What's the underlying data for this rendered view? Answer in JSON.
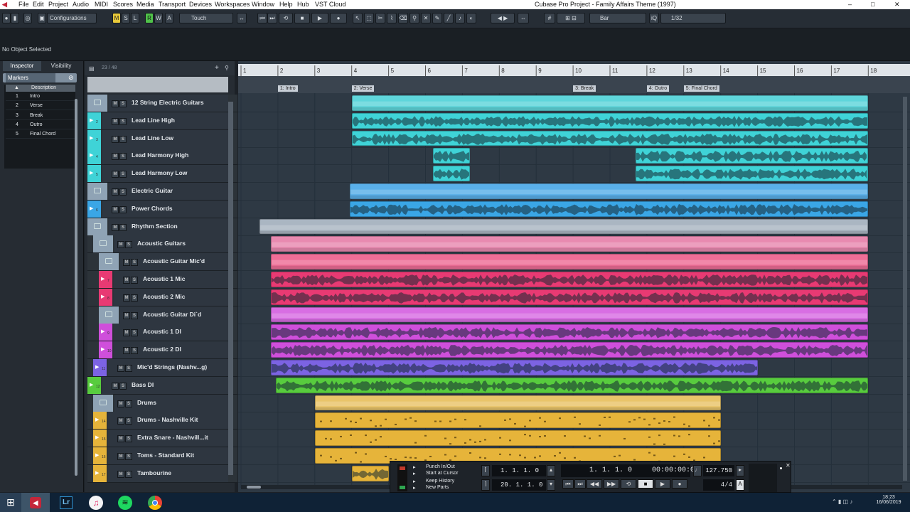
{
  "menu": [
    "File",
    "Edit",
    "Project",
    "Audio",
    "MIDI",
    "Scores",
    "Media",
    "Transport",
    "Devices",
    "Workspaces",
    "Window",
    "Help",
    "Hub",
    "VST Cloud"
  ],
  "window_title": "Cubase Pro Project - Family Affairs Theme (1997)",
  "window_controls": {
    "min": "–",
    "max": "□",
    "close": "✕"
  },
  "toolbar": {
    "configurations": "Configurations",
    "state_buttons": [
      "M",
      "S",
      "L",
      "R",
      "W",
      "A"
    ],
    "automation_mode": "Touch",
    "snap_type": "Bar",
    "quantize": "1/32",
    "iq": "iQ"
  },
  "info_line": "No Object Selected",
  "inspector": {
    "tabs": [
      "Inspector",
      "Visibility"
    ],
    "section": "Markers",
    "column_header": "Description",
    "markers": [
      {
        "id": "1",
        "description": "Intro"
      },
      {
        "id": "2",
        "description": "Verse"
      },
      {
        "id": "3",
        "description": "Break"
      },
      {
        "id": "4",
        "description": "Outro"
      },
      {
        "id": "5",
        "description": "Final Chord"
      }
    ]
  },
  "tracklist": {
    "count": "23 / 48",
    "tracks": [
      {
        "name": "12 String Electric Guitars",
        "num": "",
        "indent": 0,
        "folder": true,
        "color": "#8fa3b5"
      },
      {
        "name": "Lead Line High",
        "num": "2",
        "indent": 0,
        "folder": false,
        "color": "#3fd3d7"
      },
      {
        "name": "Lead Line Low",
        "num": "3",
        "indent": 0,
        "folder": false,
        "color": "#3fd3d7"
      },
      {
        "name": "Lead Harmony High",
        "num": "4",
        "indent": 0,
        "folder": false,
        "color": "#3fd3d7"
      },
      {
        "name": "Lead Harmony Low",
        "num": "5",
        "indent": 0,
        "folder": false,
        "color": "#3fd3d7"
      },
      {
        "name": "Electric Guitar",
        "num": "",
        "indent": 0,
        "folder": true,
        "color": "#8fa3b5"
      },
      {
        "name": "Power Chords",
        "num": "6",
        "indent": 0,
        "folder": false,
        "color": "#3aa6e6"
      },
      {
        "name": "Rhythm Section",
        "num": "",
        "indent": 0,
        "folder": true,
        "color": "#8fa3b5"
      },
      {
        "name": "Acoustic Guitars",
        "num": "",
        "indent": 1,
        "folder": true,
        "color": "#8fa3b5"
      },
      {
        "name": "Acoustic Guitar Mic'd",
        "num": "",
        "indent": 2,
        "folder": true,
        "color": "#8fa3b5"
      },
      {
        "name": "Acoustic 1 Mic",
        "num": "7",
        "indent": 2,
        "folder": false,
        "color": "#e83a73"
      },
      {
        "name": "Acoustic 2 Mic",
        "num": "8",
        "indent": 2,
        "folder": false,
        "color": "#e83a73"
      },
      {
        "name": "Acoustic Guitar Di`d",
        "num": "",
        "indent": 2,
        "folder": true,
        "color": "#8fa3b5"
      },
      {
        "name": "Acoustic 1 DI",
        "num": "9",
        "indent": 2,
        "folder": false,
        "color": "#cf4fdb"
      },
      {
        "name": "Acoustic 2 DI",
        "num": "10",
        "indent": 2,
        "folder": false,
        "color": "#cf4fdb"
      },
      {
        "name": "Mic'd Strings (Nashv...g)",
        "num": "11",
        "indent": 1,
        "folder": false,
        "color": "#7c63e3"
      },
      {
        "name": "Bass DI",
        "num": "12",
        "indent": 0,
        "folder": false,
        "color": "#58cc3e"
      },
      {
        "name": "Drums",
        "num": "",
        "indent": 1,
        "folder": true,
        "color": "#8fa3b5"
      },
      {
        "name": "Drums - Nashville Kit",
        "num": "14",
        "indent": 1,
        "folder": false,
        "color": "#e6b43a"
      },
      {
        "name": "Extra Snare - Nashvill...it",
        "num": "15",
        "indent": 1,
        "folder": false,
        "color": "#e6b43a"
      },
      {
        "name": "Toms - Standard Kit",
        "num": "16",
        "indent": 1,
        "folder": false,
        "color": "#e6b43a"
      },
      {
        "name": "Tambourine",
        "num": "17",
        "indent": 1,
        "folder": false,
        "color": "#e6b43a"
      }
    ]
  },
  "ruler": {
    "bars": [
      "1",
      "2",
      "3",
      "4",
      "5",
      "6",
      "7",
      "8",
      "9",
      "10",
      "11",
      "12",
      "13",
      "14",
      "15",
      "16",
      "17",
      "18"
    ],
    "markers": [
      {
        "label": "1: Intro",
        "bar": 2
      },
      {
        "label": "2: Verse",
        "bar": 4
      },
      {
        "label": "3: Break",
        "bar": 10
      },
      {
        "label": "4: Outro",
        "bar": 12
      },
      {
        "label": "5: Final Chord",
        "bar": 13
      }
    ]
  },
  "clips": [
    {
      "track": 0,
      "start": 4,
      "end": 18,
      "color": "#5fd6db",
      "kind": "folder"
    },
    {
      "track": 1,
      "start": 4,
      "end": 18,
      "color": "#3fd3d7",
      "kind": "audio"
    },
    {
      "track": 2,
      "start": 4,
      "end": 18,
      "color": "#3fd3d7",
      "kind": "audio"
    },
    {
      "track": 3,
      "start": 6.2,
      "end": 7.2,
      "color": "#3fd3d7",
      "kind": "audio"
    },
    {
      "track": 3,
      "start": 11.7,
      "end": 18,
      "color": "#3fd3d7",
      "kind": "audio"
    },
    {
      "track": 4,
      "start": 6.2,
      "end": 7.2,
      "color": "#3fd3d7",
      "kind": "audio"
    },
    {
      "track": 4,
      "start": 11.7,
      "end": 18,
      "color": "#3fd3d7",
      "kind": "audio"
    },
    {
      "track": 5,
      "start": 3.95,
      "end": 18,
      "color": "#5ab0ea",
      "kind": "folder"
    },
    {
      "track": 6,
      "start": 3.95,
      "end": 18,
      "color": "#3aa6e6",
      "kind": "audio"
    },
    {
      "track": 7,
      "start": 1.5,
      "end": 18,
      "color": "#aab6c2",
      "kind": "folder"
    },
    {
      "track": 8,
      "start": 1.8,
      "end": 18,
      "color": "#e88ab0",
      "kind": "folder"
    },
    {
      "track": 9,
      "start": 1.8,
      "end": 18,
      "color": "#ee6e97",
      "kind": "folder"
    },
    {
      "track": 10,
      "start": 1.8,
      "end": 18,
      "color": "#e83a73",
      "kind": "audio"
    },
    {
      "track": 11,
      "start": 1.8,
      "end": 18,
      "color": "#e83a73",
      "kind": "audio"
    },
    {
      "track": 12,
      "start": 1.8,
      "end": 18,
      "color": "#d86ee3",
      "kind": "folder"
    },
    {
      "track": 13,
      "start": 1.8,
      "end": 18,
      "color": "#cf4fdb",
      "kind": "audio"
    },
    {
      "track": 14,
      "start": 1.8,
      "end": 18,
      "color": "#cf4fdb",
      "kind": "audio"
    },
    {
      "track": 15,
      "start": 1.8,
      "end": 15,
      "color": "#7c63e3",
      "kind": "audio"
    },
    {
      "track": 16,
      "start": 1.95,
      "end": 18,
      "color": "#58cc3e",
      "kind": "audio"
    },
    {
      "track": 17,
      "start": 3,
      "end": 14,
      "color": "#e9c46a",
      "kind": "folder"
    },
    {
      "track": 18,
      "start": 3,
      "end": 14,
      "color": "#e6b43a",
      "kind": "midi"
    },
    {
      "track": 19,
      "start": 3,
      "end": 14,
      "color": "#e6b43a",
      "kind": "midi"
    },
    {
      "track": 20,
      "start": 3,
      "end": 14,
      "color": "#e6b43a",
      "kind": "midi"
    },
    {
      "track": 21,
      "start": 4,
      "end": 5,
      "color": "#e6b43a",
      "kind": "audio"
    }
  ],
  "transport": {
    "items": [
      "Punch In/Out",
      "Start at Cursor",
      "Keep History",
      "New Parts"
    ],
    "left_locator": "1. 1. 1.    0",
    "right_locator": "20. 1. 1.    0",
    "position_bars": "1. 1. 1.    0",
    "position_time": "00:00:00:00",
    "tempo": "127.750",
    "signature": "4/4"
  },
  "taskbar": {
    "time": "18:23",
    "date": "16/06/2019",
    "apps": [
      "cubase-icon",
      "lightroom-icon",
      "itunes-icon",
      "spotify-icon",
      "chrome-icon"
    ],
    "lr_label": "Lr"
  }
}
